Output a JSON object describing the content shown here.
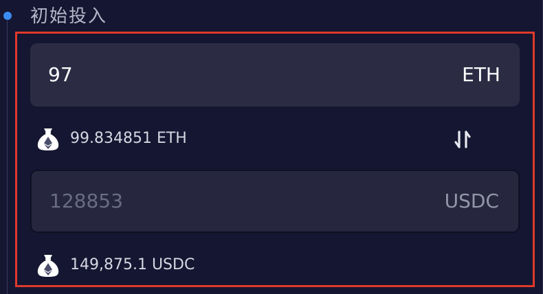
{
  "section": {
    "title": "初始投入"
  },
  "eth_input": {
    "value": "97",
    "unit": "ETH"
  },
  "eth_balance": {
    "text": "99.834851 ETH",
    "icon": "money-bag-eth-icon"
  },
  "swap": {
    "icon": "swap-arrows-icon"
  },
  "usdc_input": {
    "value": "128853",
    "unit": "USDC"
  },
  "usdc_balance": {
    "text": "149,875.1 USDC",
    "icon": "money-bag-eth-icon"
  },
  "colors": {
    "background": "#151631",
    "field": "#2b2c44",
    "highlight": "#e0392c",
    "timeline_dot": "#3b8cf2"
  }
}
